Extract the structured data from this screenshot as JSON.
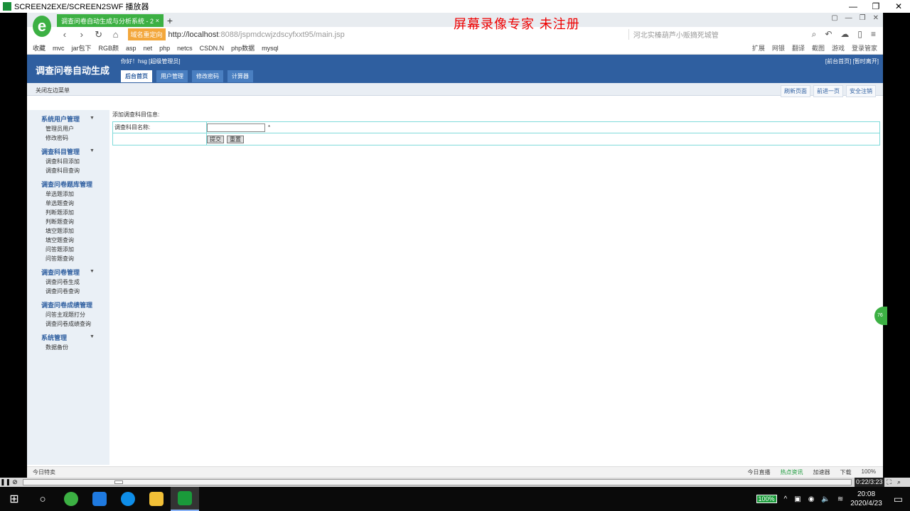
{
  "player": {
    "title": "SCREEN2EXE/SCREEN2SWF 播放器",
    "time": "0:22/3:23"
  },
  "browser": {
    "tab_title": "调查问卷自动生成与分析系统 - 2",
    "watermark": "屏幕录像专家  未注册",
    "address_badge": "域名重定向",
    "url_host": "http://localhost",
    "url_rest": ":8088/jspmdcwjzdscyfxxt95/main.jsp",
    "search_text": "河北实榛葫芦小贩摘死城管",
    "bookmarks": [
      "收藏",
      "mvc",
      "jar包下",
      "RGB颜",
      "asp",
      "net",
      "php",
      "netcs",
      "CSDN.N",
      "php数据",
      "mysql"
    ],
    "bookmark_right": [
      "扩展",
      "网银",
      "翻译",
      "截图",
      "游戏",
      "登录管家"
    ]
  },
  "site": {
    "title": "调查问卷自动生成",
    "welcome": "你好！hsg [超级管理员]",
    "toplinks": "[前台首页] [暂时离开]",
    "menu": [
      "后台首页",
      "用户管理",
      "修改密码",
      "计算器"
    ],
    "close_menu": "关闭左边菜单",
    "sub_buttons": [
      "刷新页面",
      "前进一页",
      "安全注销"
    ]
  },
  "sidebar": [
    {
      "group": "系统用户管理",
      "items": [
        "管理员用户",
        "修改密码"
      ]
    },
    {
      "group": "调查科目管理",
      "items": [
        "调查科目添加",
        "调查科目查询"
      ]
    },
    {
      "group": "调查问卷题库管理",
      "items": [
        "单选题添加",
        "单选题查询",
        "判断题添加",
        "判断题查询",
        "填空题添加",
        "填空题查询",
        "问答题添加",
        "问答题查询"
      ]
    },
    {
      "group": "调查问卷管理",
      "items": [
        "调查问卷生成",
        "调查问卷查询"
      ]
    },
    {
      "group": "调查问卷成绩管理",
      "items": [
        "问答主观题打分",
        "调查问卷成绩查询"
      ]
    },
    {
      "group": "系统管理",
      "items": [
        "数据备份"
      ]
    }
  ],
  "content": {
    "title": "添加调查科目信息:",
    "field_label": "调查科目名称:",
    "field_value": "",
    "required_mark": "*",
    "submit_label": "提交",
    "reset_label": "重置"
  },
  "statusbar": {
    "left": "今日特卖",
    "right": [
      "今日直播",
      "热点资讯",
      "加速器",
      "下载",
      "100%"
    ]
  },
  "taskbar": {
    "battery": "100%",
    "time": "20:08",
    "date": "2020/4/23"
  }
}
